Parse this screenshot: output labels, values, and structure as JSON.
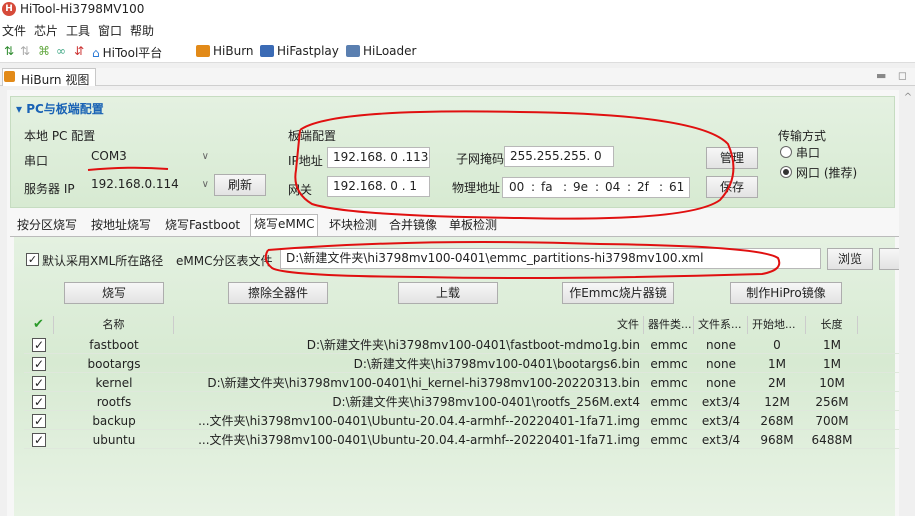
{
  "app": {
    "title": "HiTool-Hi3798MV100",
    "icon": "hitool-logo-icon"
  },
  "menu": [
    "文件",
    "芯片",
    "工具",
    "窗口",
    "帮助"
  ],
  "toolbar": {
    "items": [
      {
        "label": "HiTool平台",
        "icon": "home-icon",
        "color": "#2a7ad6"
      },
      {
        "label": "HiBurn",
        "icon": "burn-icon",
        "color": "#e28a18"
      },
      {
        "label": "HiFastplay",
        "icon": "fastplay-icon",
        "color": "#3b6bb5"
      },
      {
        "label": "HiLoader",
        "icon": "loader-icon",
        "color": "#5a7fb0"
      }
    ]
  },
  "view_tab": {
    "label": "HiBurn 视图"
  },
  "pc_config": {
    "header": "▾ PC与板端配置",
    "local_label": "本地 PC 配置",
    "serial_label": "串口",
    "serial_value": "COM3",
    "server_label": "服务器 IP",
    "server_value": "192.168.0.114",
    "refresh_label": "刷新",
    "board_label": "板端配置",
    "ip_label": "IP地址",
    "ip_value": "192.168. 0 .113",
    "mask_label": "子网掩码",
    "mask_value": "255.255.255. 0",
    "gateway_label": "网关",
    "gateway_value": "192.168. 0 . 1",
    "mac_label": "物理地址",
    "mac_parts": [
      "00",
      "fa",
      "9e",
      "04",
      "2f",
      "61"
    ],
    "manage_label": "管理",
    "save_label": "保存",
    "transfer_label": "传输方式",
    "radio_serial": "串口",
    "radio_net": "网口 (推荐)"
  },
  "tabs": [
    {
      "label": "按分区烧写",
      "active": false
    },
    {
      "label": "按地址烧写",
      "active": false
    },
    {
      "label": "烧写Fastboot",
      "active": false
    },
    {
      "label": "烧写eMMC",
      "active": true
    },
    {
      "label": "坏块检测",
      "active": false
    },
    {
      "label": "合并镜像",
      "active": false
    },
    {
      "label": "单板检测",
      "active": false
    }
  ],
  "emmc": {
    "default_xml_label": "默认采用XML所在路径",
    "partition_label": "eMMC分区表文件",
    "partition_value": "D:\\新建文件夹\\hi3798mv100-0401\\emmc_partitions-hi3798mv100.xml",
    "browse_label": "浏览",
    "burn_label": "烧写",
    "erase_label": "擦除全器件",
    "upload_label": "上载",
    "make_emmc_label": "作Emmc烧片器镜",
    "make_hipro_label": "制作HiPro镜像"
  },
  "grid": {
    "headers": [
      "名称",
      "文件",
      "器件类...",
      "文件系...",
      "开始地...",
      "长度"
    ],
    "rows": [
      {
        "checked": "✓",
        "name": "fastboot",
        "file": "D:\\新建文件夹\\hi3798mv100-0401\\fastboot-mdmo1g.bin",
        "device": "emmc",
        "fs": "none",
        "start": "0",
        "length": "1M"
      },
      {
        "checked": "✓",
        "name": "bootargs",
        "file": "D:\\新建文件夹\\hi3798mv100-0401\\bootargs6.bin",
        "device": "emmc",
        "fs": "none",
        "start": "1M",
        "length": "1M"
      },
      {
        "checked": "✓",
        "name": "kernel",
        "file": "D:\\新建文件夹\\hi3798mv100-0401\\hi_kernel-hi3798mv100-20220313.bin",
        "device": "emmc",
        "fs": "none",
        "start": "2M",
        "length": "10M"
      },
      {
        "checked": "✓",
        "name": "rootfs",
        "file": "D:\\新建文件夹\\hi3798mv100-0401\\rootfs_256M.ext4",
        "device": "emmc",
        "fs": "ext3/4",
        "start": "12M",
        "length": "256M"
      },
      {
        "checked": "✓",
        "name": "backup",
        "file": "...文件夹\\hi3798mv100-0401\\Ubuntu-20.04.4-armhf--20220401-1fa71.img",
        "device": "emmc",
        "fs": "ext3/4",
        "start": "268M",
        "length": "700M"
      },
      {
        "checked": "✓",
        "name": "ubuntu",
        "file": "...文件夹\\hi3798mv100-0401\\Ubuntu-20.04.4-armhf--20220401-1fa71.img",
        "device": "emmc",
        "fs": "ext3/4",
        "start": "968M",
        "length": "6488M"
      }
    ]
  },
  "colors": {
    "accent": "#1a63b5",
    "panel": "#d7ead2",
    "annotation": "#e01010"
  }
}
